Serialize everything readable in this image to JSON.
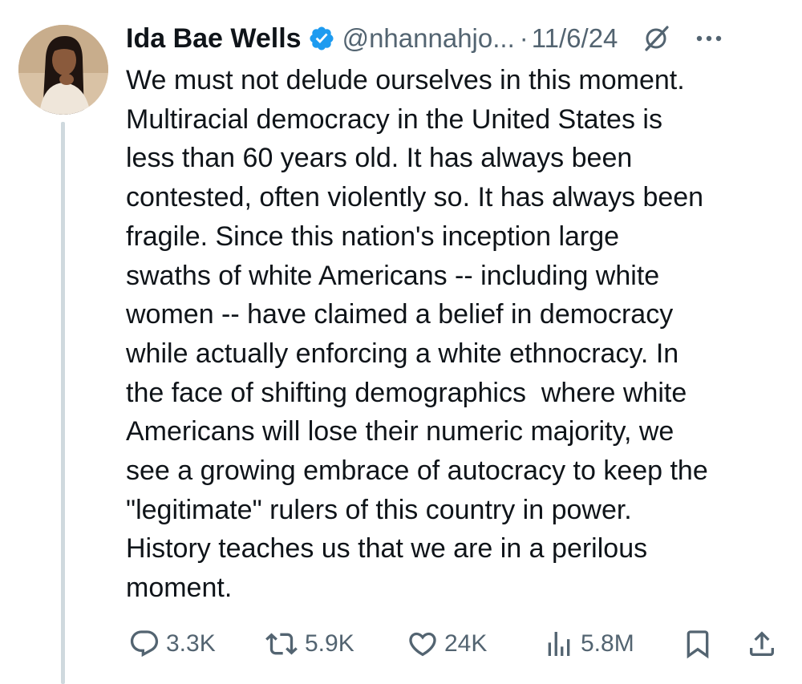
{
  "tweet": {
    "author_name": "Ida Bae Wells",
    "handle": "@nhannahjo...",
    "separator": "·",
    "date": "11/6/24",
    "body_lines": [
      "We must not delude ourselves in this moment.",
      "Multiracial democracy in the United States is",
      "less than 60 years old. It has always been",
      "contested, often violently so. It has always been",
      "fragile. Since this nation's inception large",
      "swaths of white Americans -- including white",
      "women -- have claimed a belief in democracy",
      "while actually enforcing a white ethnocracy. In",
      "the face of shifting demographics  where white",
      "Americans will lose their numeric majority, we",
      "see a growing embrace of autocracy to keep the",
      "\"legitimate\" rulers of this country in power.",
      "History teaches us that we are in a perilous",
      "moment."
    ]
  },
  "actions": {
    "replies": "3.3K",
    "reposts": "5.9K",
    "likes": "24K",
    "views": "5.8M"
  },
  "icons": {
    "verified": "verified-badge-icon",
    "grok": "grok-icon",
    "more": "more-icon",
    "reply": "reply-icon",
    "repost": "repost-icon",
    "like": "like-icon",
    "views": "views-icon",
    "bookmark": "bookmark-icon",
    "share": "share-icon"
  },
  "colors": {
    "text": "#0f1419",
    "secondary": "#536471",
    "verified": "#1d9bf0",
    "thread_line": "#cfd9de"
  }
}
